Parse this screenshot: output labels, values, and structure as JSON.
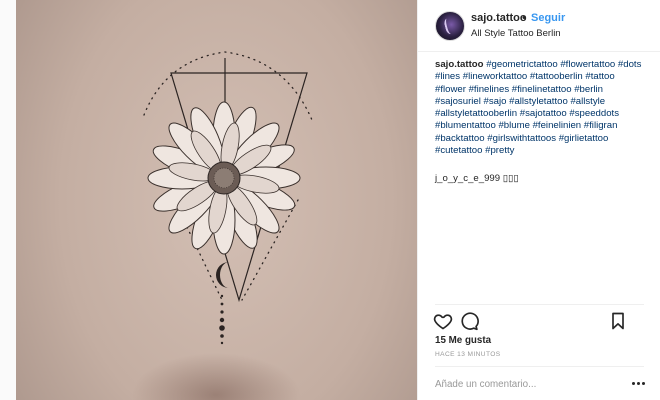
{
  "post": {
    "username": "sajo.tattoo",
    "separator": "•",
    "follow_label": "Seguir",
    "location": "All Style Tattoo Berlin"
  },
  "caption": {
    "username": "sajo.tattoo",
    "hashtags_text": "#geometrictattoo #flowertattoo #dots #lines #lineworktattoo #tattooberlin #tattoo #flower #finelines #finelinetattoo #berlin #sajosuriel #sajo #allstyletattoo #allstyle #allstyletattooberlin #sajotattoo #speeddots #blumentattoo #blume #feinelinien #filigran #backtattoo #girlswithtattoos #girlietattoo #cutetattoo #pretty"
  },
  "comments": [
    {
      "username": "j_o_y_c_e_999",
      "text": "▯▯▯"
    }
  ],
  "actions": {
    "likes_text": "15 Me gusta",
    "timestamp": "HACE 13 MINUTOS"
  },
  "comment_box": {
    "placeholder": "Añade un comentario...",
    "value": ""
  },
  "icons": {
    "like": "heart-icon",
    "comment": "speech-bubble-icon",
    "save": "bookmark-icon",
    "more": "ellipsis-icon"
  },
  "colors": {
    "link": "#3897f0",
    "hashtag": "#003569",
    "muted": "#999999",
    "border": "#efefef"
  }
}
